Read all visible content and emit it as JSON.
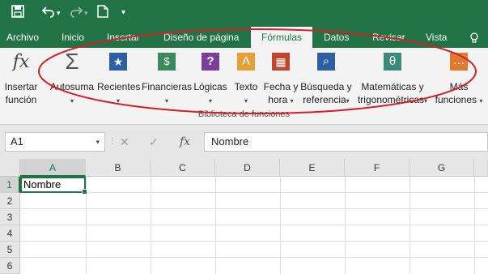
{
  "quick_access": {
    "save_icon": "save-icon",
    "undo_icon": "undo-icon",
    "redo_icon": "redo-icon",
    "new_icon": "new-document-icon",
    "customize_icon": "chevron-down-icon"
  },
  "tabs": [
    {
      "label": "Archivo"
    },
    {
      "label": "Inicio"
    },
    {
      "label": "Insertar"
    },
    {
      "label": "Diseño de página"
    },
    {
      "label": "Fórmulas"
    },
    {
      "label": "Datos"
    },
    {
      "label": "Revisar"
    },
    {
      "label": "Vista"
    }
  ],
  "tell_me_icon": "lightbulb-icon",
  "ribbon": {
    "insert_function": {
      "line1": "Insertar",
      "line2": "función",
      "icon": "fx"
    },
    "buttons": [
      {
        "line1": "Autosuma",
        "icon": "Σ",
        "color": "#555555"
      },
      {
        "line1": "Recientes",
        "icon": "★",
        "color": "#2e5fa3"
      },
      {
        "line1": "Financieras",
        "icon": "$",
        "color": "#3a8a5c"
      },
      {
        "line1": "Lógicas",
        "icon": "?",
        "color": "#7b3f99"
      },
      {
        "line1": "Texto",
        "icon": "A",
        "color": "#e8a035"
      },
      {
        "line1": "Fecha y",
        "line2": "hora",
        "icon": "▦",
        "color": "#c0452d"
      },
      {
        "line1": "Búsqueda y",
        "line2": "referencia",
        "icon": "⌕",
        "color": "#2e5fa3"
      },
      {
        "line1": "Matemáticas y",
        "line2": "trigonométricas",
        "icon": "θ",
        "color": "#3a8a7a"
      },
      {
        "line1": "Más",
        "line2": "funciones",
        "icon": "…",
        "color": "#e07a2e"
      }
    ],
    "group_label": "Biblioteca de funciones"
  },
  "formula_bar": {
    "name_box": "A1",
    "fx": "fx",
    "content": "Nombre"
  },
  "grid": {
    "columns": [
      "A",
      "B",
      "C",
      "D",
      "E",
      "F",
      "G"
    ],
    "rows": [
      "1",
      "2",
      "3",
      "4",
      "5",
      "6"
    ],
    "cell_a1": "Nombre"
  },
  "colors": {
    "accent": "#217346",
    "annotation": "#d21f2b"
  }
}
